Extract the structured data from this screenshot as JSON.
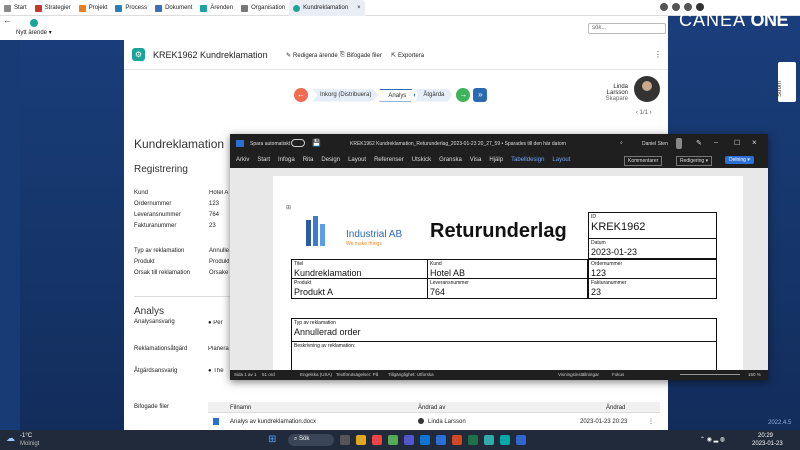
{
  "browser_tabs": [
    "Start",
    "Strategier",
    "Projekt",
    "Process",
    "Dokument",
    "Ärenden",
    "Organisation",
    "Kundreklamation"
  ],
  "new_issue": "Nytt ärende",
  "search_placeholder": "sök...",
  "brand": {
    "a": "CANEA",
    "b": " ONE"
  },
  "record": {
    "title": "KREK1962 Kundreklamation",
    "edit": "Redigera ärende",
    "attachments": "Bifogade filer",
    "export": "Exportera"
  },
  "workflow": {
    "steps": [
      "Inkorg (Distribuera)",
      "Analys",
      "Åtgärda"
    ],
    "page": "1/1"
  },
  "person": {
    "name": "Linda Larsson",
    "role": "Skapare"
  },
  "stream": "Ström",
  "page": {
    "heading": "Kundreklamation",
    "registrering": "Registrering",
    "labels": [
      "Kund",
      "Ordernummer",
      "Leveransnummer",
      "Fakturanummer",
      "Typ av reklamation",
      "Produkt",
      "Orsak till reklamation"
    ],
    "values": [
      "Hotel A",
      "123",
      "764",
      "23",
      "Annuller",
      "Produkt",
      "Orsake"
    ],
    "analys": "Analys",
    "analys_labels": [
      "Analysansvarig",
      "Reklamationsåtgärd",
      "Åtgärdsansvarig"
    ],
    "analys_values": [
      "Per",
      "Planera",
      "The"
    ]
  },
  "word": {
    "autosave": "Spara automatiskt",
    "filename": "KREK1962 Kundreklamation_Returunderlag_2023-01-23 20_27_59 • Sparades till den här datorn",
    "user": "Daniel Sten",
    "menu": [
      "Arkiv",
      "Start",
      "Infoga",
      "Rita",
      "Design",
      "Layout",
      "Referenser",
      "Utskick",
      "Granska",
      "Visa",
      "Hjälp",
      "Tabelldesign",
      "Layout"
    ],
    "comments": "Kommentarer",
    "editing": "Redigering",
    "share": "Delning",
    "status_left": "Sida 1 av 1",
    "words": "51 ord",
    "lang": "Engelska (USA)",
    "predict": "Textförutsägelser: På",
    "access": "Tillgänglighet: Utforska",
    "view": "Visningsinställningar",
    "focus": "Fokus",
    "zoom": "150 %"
  },
  "doc": {
    "company": "Industrial AB",
    "tagline": "We make things",
    "heading": "Returunderlag",
    "id_label": "ID",
    "id": "KREK1962",
    "datum_label": "Datum",
    "datum": "2023-01-23",
    "titel_label": "Titel",
    "titel": "Kundreklamation",
    "kund_label": "Kund",
    "kund": "Hotel AB",
    "order_label": "Ordernummer",
    "order": "123",
    "produkt_label": "Produkt",
    "produkt": "Produkt A",
    "lev_label": "Leveransnummer",
    "lev": "764",
    "faktura_label": "Fakturanummer",
    "faktura": "23",
    "typ_label": "Typ av reklamation",
    "typ": "Annullerad order",
    "beskr_label": "Beskrivning av reklamation:"
  },
  "files": {
    "label": "Bifogade filer",
    "col_name": "Filnamn",
    "col_changed_by": "Ändrad av",
    "col_changed": "Ändrad",
    "file": "Analys av kundreklamation.docx",
    "by": "Linda Larsson",
    "date": "2023-01-23 20:23",
    "version": "2022.4.5"
  },
  "taskbar": {
    "temp": "-1°C",
    "weather": "Molnigt",
    "search": "Sök",
    "time": "20:29",
    "date": "2023-01-23"
  }
}
